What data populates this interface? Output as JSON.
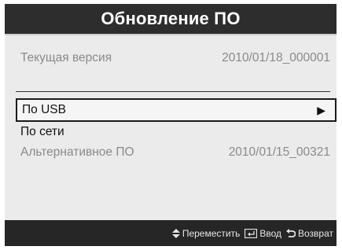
{
  "dialog": {
    "title": "Обновление ПО"
  },
  "current_version": {
    "label": "Текущая версия",
    "value": "2010/01/18_000001"
  },
  "menu": {
    "usb": {
      "label": "По USB",
      "arrow": "▶"
    },
    "network": {
      "label": "По сети"
    },
    "alternative": {
      "label": "Альтернативное ПО",
      "value": "2010/01/15_00321"
    }
  },
  "footer": {
    "move": {
      "icon": "up-down-arrows-icon",
      "label": "Переместить"
    },
    "enter": {
      "icon": "enter-icon",
      "label": "Ввод"
    },
    "back": {
      "icon": "return-arrow-icon",
      "label": "Возврат"
    }
  }
}
